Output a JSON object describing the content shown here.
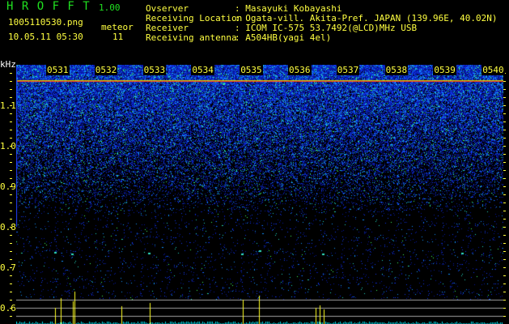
{
  "app": {
    "name": "H R O F F T",
    "version": "1.00"
  },
  "file": {
    "name": "1005110530.png",
    "datetime": "10.05.11 05:30"
  },
  "meteor": {
    "label": "meteor",
    "count": "11"
  },
  "info": [
    {
      "label": "Ovserver",
      "value": ": Masayuki Kobayashi"
    },
    {
      "label": "Receiving Location",
      "value": ": Ogata-vill. Akita-Pref. JAPAN (139.96E, 40.02N)"
    },
    {
      "label": "Receiver",
      "value": ": ICOM IC-575 53.7492(@LCD)MHz USB"
    },
    {
      "label": "Receiving antenna",
      "value": ": A504HB(yagi 4el)"
    }
  ],
  "axis": {
    "unit": "kHz",
    "y_labels": [
      "1.1",
      "1.0",
      "0.9",
      "0.8",
      "0.7",
      "0.6"
    ],
    "time_labels": [
      "0531",
      "0532",
      "0533",
      "0534",
      "0535",
      "0536",
      "0537",
      "0538",
      "0539",
      "0540"
    ]
  }
}
